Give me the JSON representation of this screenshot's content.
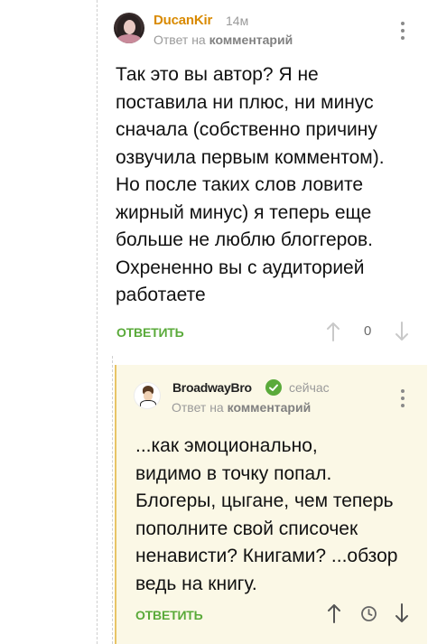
{
  "comment_1": {
    "author": "DucanKir",
    "time": "14м",
    "reply_prefix": "Ответ на",
    "reply_target": "комментарий",
    "text": "Так это вы автор? Я не\nпоставила ни плюс, ни минус\nсначала (собственно причину\nозвучила первым комментом).\nНо после таких слов ловите\nжирный минус) я теперь еще\nбольше не люблю блоггеров.\nОхрененно вы с аудиторией\nработаете",
    "answer_label": "ОТВЕТИТЬ",
    "score": "0",
    "author_color": "#d98a00"
  },
  "comment_2": {
    "author": "BroadwayBro",
    "time": "сейчас",
    "reply_prefix": "Ответ на",
    "reply_target": "комментарий",
    "text": "...как эмоционально,\nвидимо в точку попал.\nБлогеры, цыгане, чем теперь\nпополните свой списочек\nненависти? Книгами? ...обзор\nведь на книгу.",
    "answer_label": "ОТВЕТИТЬ",
    "verified": true,
    "highlight_color": "#fbf8e6"
  },
  "icons": {
    "more": "kebab-menu-icon",
    "upvote": "arrow-up-icon",
    "downvote": "arrow-down-icon",
    "pending": "clock-icon",
    "verified": "check-badge-icon"
  },
  "colors": {
    "accent_green": "#5aaa3a",
    "muted_text": "#9a9a9a"
  }
}
